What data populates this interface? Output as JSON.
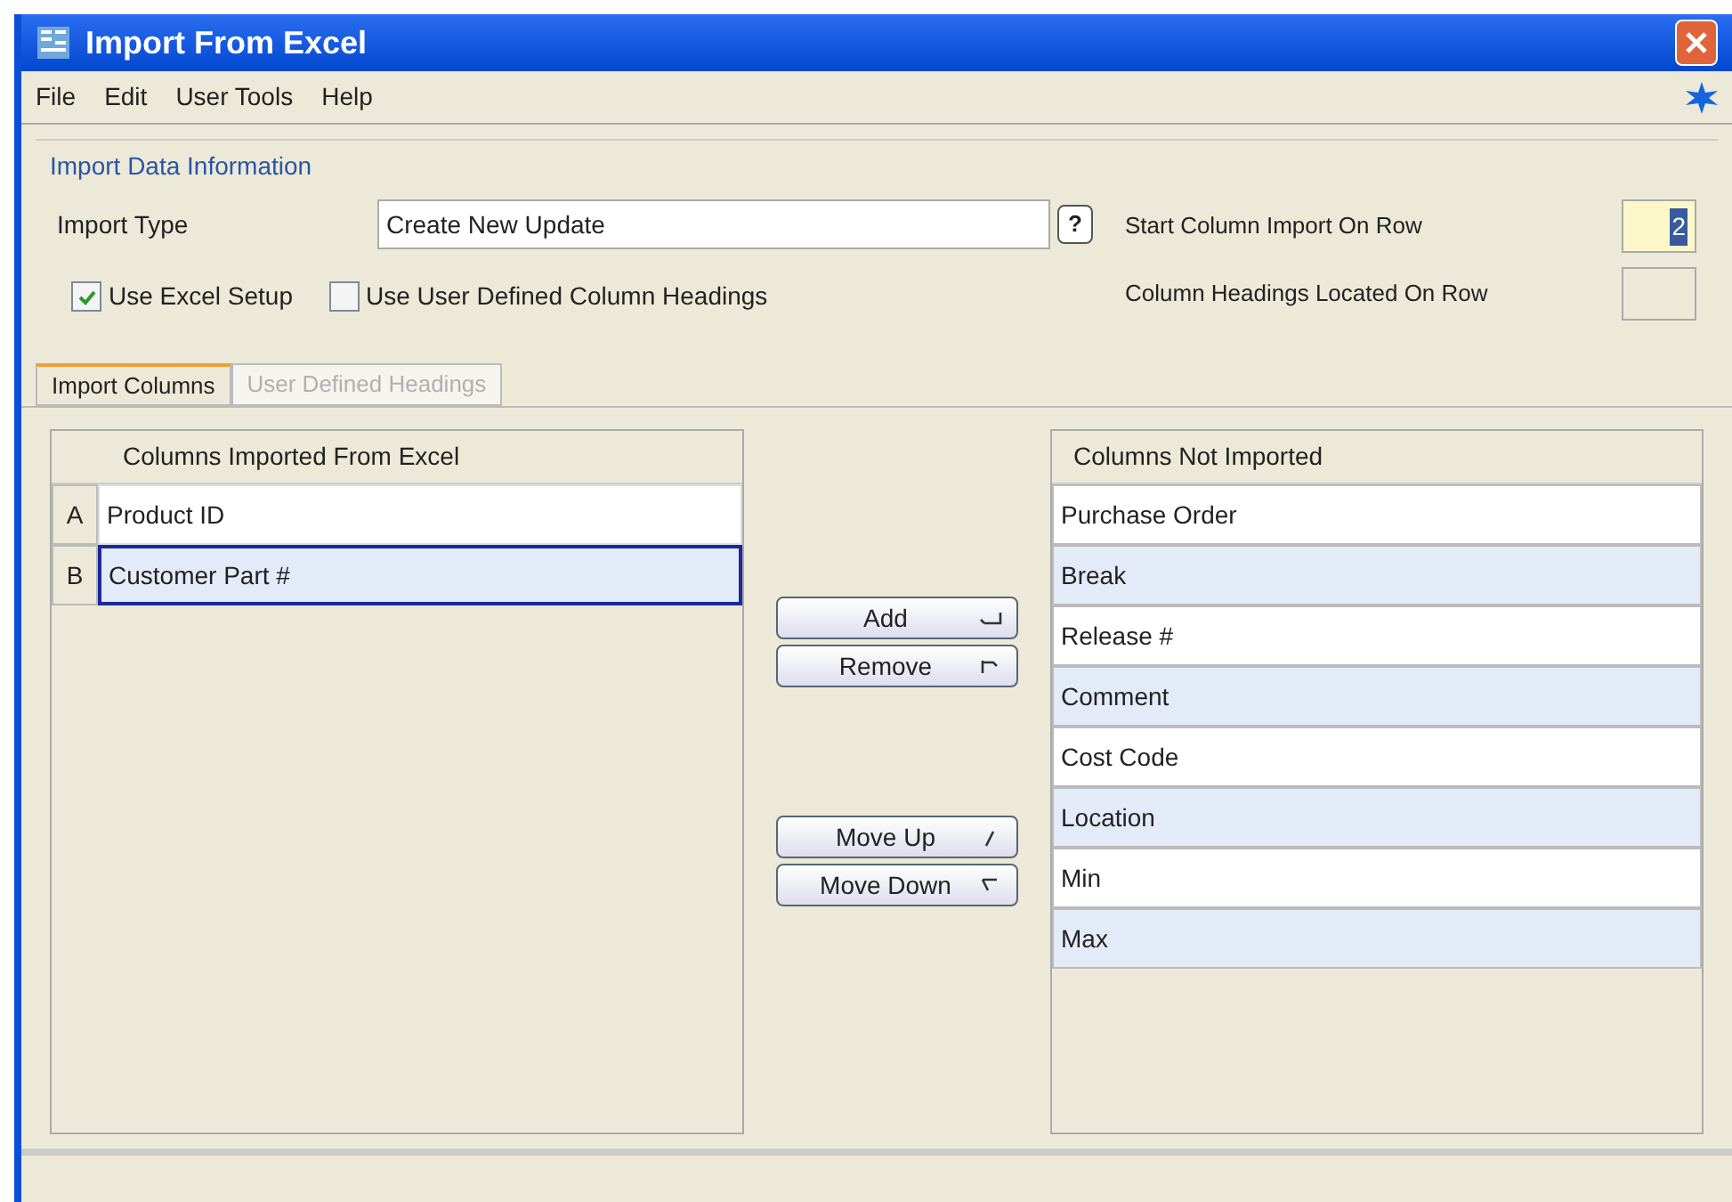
{
  "window": {
    "title": "Import From Excel"
  },
  "menu": [
    "File",
    "Edit",
    "User Tools",
    "Help"
  ],
  "group": {
    "title": "Import Data Information",
    "import_type": {
      "label": "Import Type",
      "value": "Create New Update",
      "help": "?"
    },
    "checkboxes": [
      {
        "label": "Use Excel Setup",
        "checked": true
      },
      {
        "label": "Use User Defined Column Headings",
        "checked": false
      }
    ],
    "row_fields": [
      {
        "label": "Start Column Import On Row",
        "value": "2",
        "focused": true
      },
      {
        "label": "Column Headings Located On Row",
        "focused": false
      }
    ]
  },
  "tabs": [
    {
      "label": "Import Columns",
      "selected": true,
      "disabled": false
    },
    {
      "label": "User Defined Headings",
      "selected": false,
      "disabled": true
    }
  ],
  "imported": {
    "heading": "Columns Imported From Excel",
    "rows": [
      {
        "letter": "A",
        "name": "Product ID",
        "selected": false
      },
      {
        "letter": "B",
        "name": "Customer Part #",
        "selected": true
      }
    ]
  },
  "buttons": [
    {
      "label": "Add",
      "kind": "add"
    },
    {
      "label": "Remove",
      "kind": "remove"
    },
    {
      "label": "Move Up",
      "kind": "up"
    },
    {
      "label": "Move Down",
      "kind": "down"
    }
  ],
  "not_imported": {
    "heading": "Columns Not Imported",
    "rows": [
      "Purchase Order",
      "Break",
      "Release #",
      "Comment",
      "Cost Code",
      "Location",
      "Min",
      "Max"
    ]
  }
}
